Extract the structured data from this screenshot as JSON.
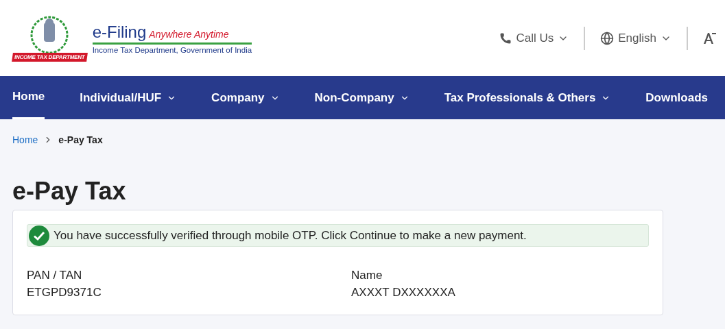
{
  "logo": {
    "ribbon": "INCOME TAX DEPARTMENT",
    "title": "e-Filing",
    "tagline": "Anywhere Anytime",
    "subtitle": "Income Tax Department, Government of India"
  },
  "header_actions": [
    {
      "kind": "phone",
      "label": "Call Us"
    },
    {
      "kind": "language",
      "label": "English"
    }
  ],
  "nav": [
    {
      "label": "Home",
      "selected": true,
      "dropdown": false
    },
    {
      "label": "Individual/HUF",
      "selected": false,
      "dropdown": true
    },
    {
      "label": "Company",
      "selected": false,
      "dropdown": true
    },
    {
      "label": "Non-Company",
      "selected": false,
      "dropdown": true
    },
    {
      "label": "Tax Professionals & Others",
      "selected": false,
      "dropdown": true
    },
    {
      "label": "Downloads",
      "selected": false,
      "dropdown": false
    }
  ],
  "breadcrumb": [
    "Home",
    "e-Pay Tax"
  ],
  "page_title": "e-Pay Tax",
  "alert": {
    "message": "You have successfully verified through mobile OTP. Click Continue to make a new payment."
  },
  "details": [
    {
      "label": "PAN / TAN",
      "value": "ETGPD9371C"
    },
    {
      "label": "Name",
      "value": "AXXXT DXXXXXXA"
    }
  ]
}
